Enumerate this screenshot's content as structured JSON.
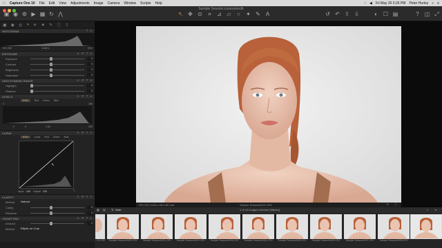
{
  "menubar": {
    "app_name": "Capture One 10",
    "items": [
      "File",
      "Edit",
      "View",
      "Adjustments",
      "Image",
      "Camera",
      "Window",
      "Scripts",
      "Help"
    ],
    "datetime": "Fri May 26  5:26 PM",
    "user": "Peter Hurley"
  },
  "toolbar": {
    "document_title": "Sample Session.cosessiondb"
  },
  "histogram": {
    "title": "HISTOGRAM",
    "iso": "ISO 200",
    "shutter": "1/160 s",
    "aperture": "f/8.0"
  },
  "exposure": {
    "title": "EXPOSURE",
    "sliders": [
      {
        "label": "Exposure",
        "value": "0"
      },
      {
        "label": "Contrast",
        "value": "0"
      },
      {
        "label": "Brightness",
        "value": "0"
      },
      {
        "label": "Saturation",
        "value": "0"
      }
    ]
  },
  "hdr": {
    "title": "HIGH DYNAMIC RANGE",
    "sliders": [
      {
        "label": "Highlight",
        "value": "0"
      },
      {
        "label": "Shadow",
        "value": "0"
      }
    ]
  },
  "levels": {
    "title": "LEVELS",
    "tabs": [
      "RGB",
      "Red",
      "Green",
      "Blue"
    ],
    "low": "0",
    "mid": "1.00",
    "high": "255",
    "top_low": "0",
    "top_high": "255"
  },
  "curve": {
    "title": "CURVE",
    "tabs": [
      "RGB",
      "Luma",
      "Red",
      "Green",
      "Blue"
    ],
    "input_label": "Input:",
    "input_value": "143",
    "output_label": "Output:",
    "output_value": "143"
  },
  "clarity": {
    "title": "CLARITY",
    "method_label": "Method",
    "method_value": "Natural",
    "sliders": [
      {
        "label": "Clarity",
        "value": "0"
      },
      {
        "label": "Structure",
        "value": "0"
      }
    ]
  },
  "vignetting": {
    "title": "VIGNETTING",
    "amount_label": "Amount",
    "amount_value": "0",
    "method_label": "Method",
    "method_value": "Elliptic on Crop"
  },
  "viewer": {
    "info_left": "ISO 200    1/160 s    f/8.0    80 mm",
    "filename": "Sample Session0421.CR2"
  },
  "browser": {
    "folder": "Note",
    "count": "1 of 14 images selected (filtered)",
    "thumbs": [
      "...01.CR2",
      "Sample Session0420.CR2",
      "Sample Session0421.CR2",
      "Sample Session0422.CR2",
      "Sample Session0423.CR2",
      "Sample Session0424.CR2",
      "Sample Session0425.CR2",
      "Sample Session0426.CR2",
      "Sample Session0427.CR2",
      "Sample Session0428.CR2"
    ]
  },
  "colors": {
    "accent": "#e08a2c",
    "panel": "#232323",
    "viewer_bg": "#0b0b0b"
  }
}
